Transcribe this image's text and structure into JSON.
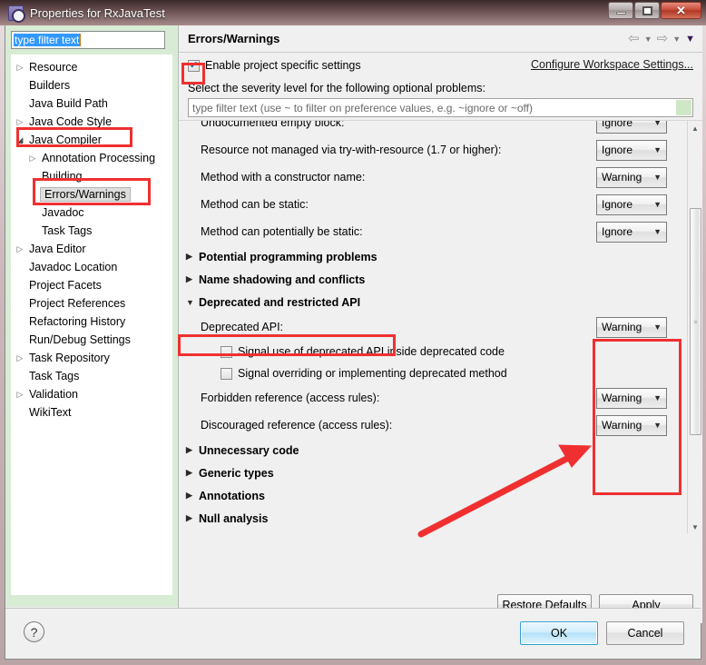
{
  "window": {
    "title": "Properties for RxJavaTest",
    "icon": "properties-gear-icon",
    "minimize_label": "",
    "maximize_label": "",
    "close_label": "✕"
  },
  "sidebar": {
    "filter": {
      "value": "type filter text",
      "placeholder": "type filter text"
    },
    "items": [
      {
        "label": "Resource",
        "arrow": "▷",
        "indent": 0,
        "selected": false
      },
      {
        "label": "Builders",
        "arrow": "",
        "indent": 0,
        "selected": false
      },
      {
        "label": "Java Build Path",
        "arrow": "",
        "indent": 0,
        "selected": false
      },
      {
        "label": "Java Code Style",
        "arrow": "▷",
        "indent": 0,
        "selected": false
      },
      {
        "label": "Java Compiler",
        "arrow": "◢",
        "indent": 0,
        "selected": false
      },
      {
        "label": "Annotation Processing",
        "arrow": "▷",
        "indent": 1,
        "selected": false
      },
      {
        "label": "Building",
        "arrow": "",
        "indent": 1,
        "selected": false
      },
      {
        "label": "Errors/Warnings",
        "arrow": "",
        "indent": 1,
        "selected": true
      },
      {
        "label": "Javadoc",
        "arrow": "",
        "indent": 1,
        "selected": false
      },
      {
        "label": "Task Tags",
        "arrow": "",
        "indent": 1,
        "selected": false
      },
      {
        "label": "Java Editor",
        "arrow": "▷",
        "indent": 0,
        "selected": false
      },
      {
        "label": "Javadoc Location",
        "arrow": "",
        "indent": 0,
        "selected": false
      },
      {
        "label": "Project Facets",
        "arrow": "",
        "indent": 0,
        "selected": false
      },
      {
        "label": "Project References",
        "arrow": "",
        "indent": 0,
        "selected": false
      },
      {
        "label": "Refactoring History",
        "arrow": "",
        "indent": 0,
        "selected": false
      },
      {
        "label": "Run/Debug Settings",
        "arrow": "",
        "indent": 0,
        "selected": false
      },
      {
        "label": "Task Repository",
        "arrow": "▷",
        "indent": 0,
        "selected": false
      },
      {
        "label": "Task Tags",
        "arrow": "",
        "indent": 0,
        "selected": false
      },
      {
        "label": "Validation",
        "arrow": "▷",
        "indent": 0,
        "selected": false
      },
      {
        "label": "WikiText",
        "arrow": "",
        "indent": 0,
        "selected": false
      }
    ],
    "hscroll": {
      "left_arrow": "◀",
      "right_arrow": "▶",
      "grip": "|||"
    }
  },
  "page": {
    "title": "Errors/Warnings",
    "nav": {
      "back_icon": "⇦",
      "back_caret": "▼",
      "forward_icon": "⇨",
      "forward_caret": "▼",
      "menu_caret": "▼"
    },
    "enable_checkbox": {
      "label": "Enable project specific settings",
      "checked": true,
      "mark": "✔"
    },
    "workspace_link": "Configure Workspace Settings...",
    "select_label": "Select the severity level for the following optional problems:",
    "problem_filter": {
      "placeholder": "type filter text (use ~ to filter on preference values, e.g. ~ignore or ~off)"
    },
    "options": [
      {
        "kind": "row",
        "label": "Undocumented empty block:",
        "value": "Ignore"
      },
      {
        "kind": "row",
        "label": "Resource not managed via try-with-resource (1.7 or higher):",
        "value": "Ignore"
      },
      {
        "kind": "row",
        "label": "Method with a constructor name:",
        "value": "Warning"
      },
      {
        "kind": "row",
        "label": "Method can be static:",
        "value": "Ignore"
      },
      {
        "kind": "row",
        "label": "Method can potentially be static:",
        "value": "Ignore"
      },
      {
        "kind": "section",
        "label": "Potential programming problems",
        "arrow": "▶",
        "expanded": false
      },
      {
        "kind": "section",
        "label": "Name shadowing and conflicts",
        "arrow": "▶",
        "expanded": false
      },
      {
        "kind": "section",
        "label": "Deprecated and restricted API",
        "arrow": "▼",
        "expanded": true
      },
      {
        "kind": "row",
        "label": "Deprecated API:",
        "value": "Warning"
      },
      {
        "kind": "checkbox",
        "label": "Signal use of deprecated API inside deprecated code",
        "checked": false
      },
      {
        "kind": "checkbox",
        "label": "Signal overriding or implementing deprecated method",
        "checked": false
      },
      {
        "kind": "row",
        "label": "Forbidden reference (access rules):",
        "value": "Warning"
      },
      {
        "kind": "row",
        "label": "Discouraged reference (access rules):",
        "value": "Warning"
      },
      {
        "kind": "section",
        "label": "Unnecessary code",
        "arrow": "▶",
        "expanded": false
      },
      {
        "kind": "section",
        "label": "Generic types",
        "arrow": "▶",
        "expanded": false
      },
      {
        "kind": "section",
        "label": "Annotations",
        "arrow": "▶",
        "expanded": false
      },
      {
        "kind": "section",
        "label": "Null analysis",
        "arrow": "▶",
        "expanded": false
      }
    ],
    "combo_caret": "▼",
    "scrollbar": {
      "up_arrow": "▲",
      "down_arrow": "▼",
      "grip": "≡"
    },
    "restore_defaults_label": "Restore Defaults",
    "apply_label": "Apply"
  },
  "footer": {
    "help_icon": "?",
    "ok_label": "OK",
    "cancel_label": "Cancel"
  },
  "annotations": {
    "accent_color": "#f03030",
    "boxes": [
      "java-compiler-tree-item",
      "errors-warnings-tree-item",
      "enable-project-specific-settings-checkbox",
      "deprecated-and-restricted-api-section",
      "warning-severity-combos-group"
    ],
    "arrow": "points from lower-left to the Warning severity dropdowns"
  }
}
